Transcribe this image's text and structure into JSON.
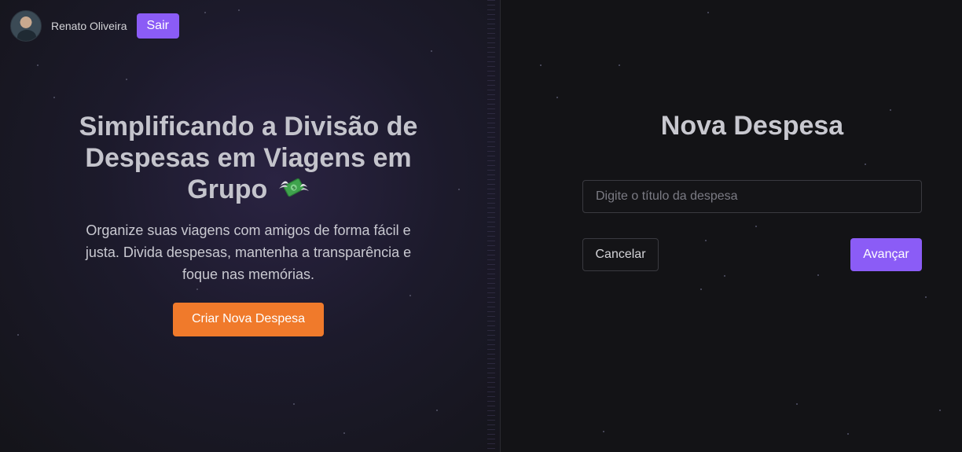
{
  "user": {
    "name": "Renato Oliveira",
    "logout_label": "Sair"
  },
  "hero": {
    "title": "Simplificando a Divisão de Despesas em Viagens em Grupo",
    "title_icon": "money-with-wings-icon",
    "description": "Organize suas viagens com amigos de forma fácil e justa. Divida despesas, mantenha a transparência e foque nas memórias.",
    "cta_label": "Criar Nova Despesa"
  },
  "form": {
    "title": "Nova Despesa",
    "title_input": {
      "value": "",
      "placeholder": "Digite o título da despesa"
    },
    "cancel_label": "Cancelar",
    "next_label": "Avançar"
  },
  "colors": {
    "primary": "#8b5cf6",
    "cta": "#f07a2b",
    "background": "#131316"
  }
}
